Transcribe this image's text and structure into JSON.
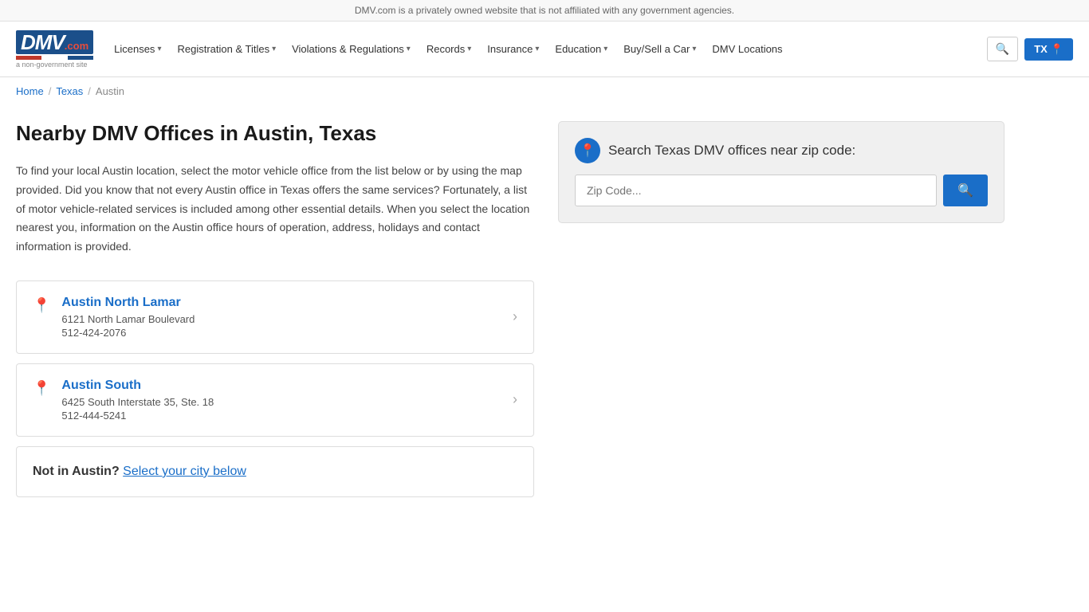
{
  "top_banner": {
    "text": "DMV.com is a privately owned website that is not affiliated with any government agencies."
  },
  "header": {
    "logo": {
      "letters": "DMV",
      "dotcom": ".com",
      "tagline": "a non-government site"
    },
    "nav": [
      {
        "label": "Licenses",
        "has_dropdown": true
      },
      {
        "label": "Registration & Titles",
        "has_dropdown": true
      },
      {
        "label": "Violations & Regulations",
        "has_dropdown": true
      },
      {
        "label": "Records",
        "has_dropdown": true
      },
      {
        "label": "Insurance",
        "has_dropdown": true
      },
      {
        "label": "Education",
        "has_dropdown": true
      },
      {
        "label": "Buy/Sell a Car",
        "has_dropdown": true
      },
      {
        "label": "DMV Locations",
        "has_dropdown": false
      }
    ],
    "search_btn_icon": "🔍",
    "state_btn_label": "TX",
    "state_btn_icon": "📍"
  },
  "breadcrumb": {
    "items": [
      {
        "label": "Home",
        "href": "#"
      },
      {
        "label": "Texas",
        "href": "#"
      },
      {
        "label": "Austin",
        "href": "#"
      }
    ]
  },
  "main": {
    "title": "Nearby DMV Offices in Austin, Texas",
    "intro": "To find your local Austin location, select the motor vehicle office from the list below or by using the map provided. Did you know that not every Austin office in Texas offers the same services? Fortunately, a list of motor vehicle-related services is included among other essential details. When you select the location nearest you, information on the Austin office hours of operation, address, holidays and contact information is provided.",
    "offices": [
      {
        "name": "Austin North Lamar",
        "address": "6121 North Lamar Boulevard",
        "phone": "512-424-2076"
      },
      {
        "name": "Austin South",
        "address": "6425 South Interstate 35, Ste. 18",
        "phone": "512-444-5241"
      }
    ]
  },
  "sidebar": {
    "zip_search": {
      "title": "Search Texas DMV offices near zip code:",
      "placeholder": "Zip Code...",
      "button_icon": "🔍"
    }
  },
  "city_section": {
    "text_prefix": "Not in Austin?",
    "text_link": "Select your city below"
  }
}
